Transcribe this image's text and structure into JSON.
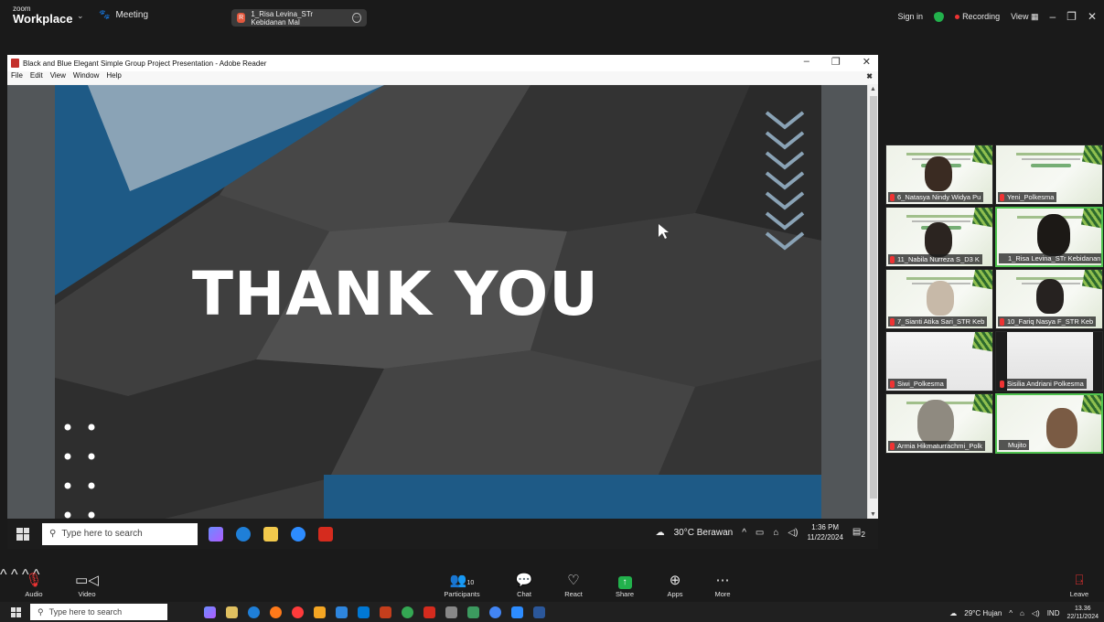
{
  "zoom": {
    "logo_small": "zoom",
    "logo_large": "Workplace",
    "meeting_label": "Meeting",
    "active_speaker": "1_Risa Levina_STr Kebidanan Mal",
    "sign_in": "Sign in",
    "recording": "Recording",
    "view": "View"
  },
  "adobe": {
    "title": "Black and Blue Elegant Simple Group Project Presentation - Adobe Reader",
    "menu": [
      "File",
      "Edit",
      "View",
      "Window",
      "Help"
    ]
  },
  "slide": {
    "headline": "THANK YOU",
    "colors": {
      "dark": "#3a3a3a",
      "blue": "#1e5a86",
      "light_blue": "#8aa3b6"
    }
  },
  "inner_taskbar": {
    "search_placeholder": "Type here to search",
    "weather": "30°C Berawan",
    "time": "1:36 PM",
    "date": "11/22/2024",
    "notif_count": "2"
  },
  "participants": [
    {
      "name": "6_Natasya Nindy Widya Pu",
      "muted": true,
      "has_face": true
    },
    {
      "name": "Yeni_Polkesma",
      "muted": true,
      "has_face": false
    },
    {
      "name": "11_Nabila Nurreza S_D3 K",
      "muted": true,
      "has_face": true
    },
    {
      "name": "1_Risa Levina_STr Kebidanan",
      "muted": false,
      "has_face": true,
      "active": true
    },
    {
      "name": "7_Sianti Atika Sari_STR Keb",
      "muted": true,
      "has_face": true
    },
    {
      "name": "10_Fariq Nasya F_STR Keb",
      "muted": true,
      "has_face": true
    },
    {
      "name": "Siwi_Polkesma",
      "muted": true,
      "has_face": false
    },
    {
      "name": "Sisilia Andriani Polkesma",
      "muted": true,
      "has_face": false
    },
    {
      "name": "Armia Hikmaturrachmi_Polk",
      "muted": true,
      "has_face": true
    },
    {
      "name": "Mujito",
      "muted": false,
      "has_face": true
    }
  ],
  "toolbar": {
    "audio": "Audio",
    "video": "Video",
    "participants": "Participants",
    "participants_count": "10",
    "chat": "Chat",
    "react": "React",
    "share": "Share",
    "apps": "Apps",
    "more": "More",
    "leave": "Leave"
  },
  "taskbar": {
    "search_placeholder": "Type here to search",
    "weather": "29°C Hujan",
    "lang": "IND",
    "time": "13.36",
    "date": "22/11/2024"
  }
}
